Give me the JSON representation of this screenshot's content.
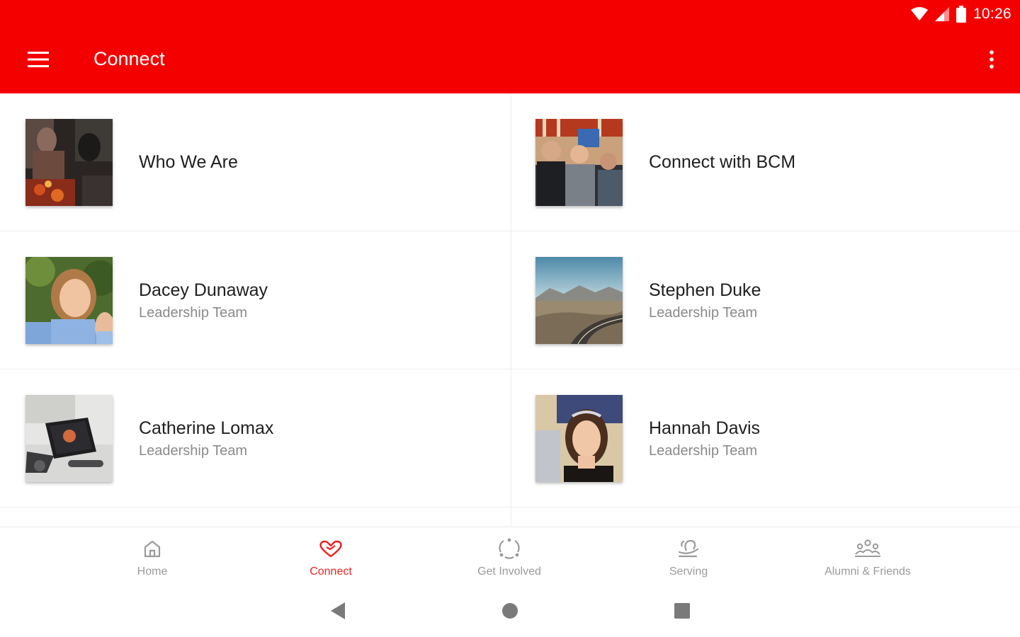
{
  "status_bar": {
    "time": "10:26",
    "icons": [
      "wifi-icon",
      "signal-icon",
      "battery-icon"
    ]
  },
  "app_bar": {
    "title": "Connect",
    "menu_icon": "hamburger-menu-icon",
    "overflow_icon": "more-vertical-icon",
    "background_color": "#f50000"
  },
  "cards": [
    {
      "title": "Who We Are",
      "subtitle": "",
      "image": "group-campfire-photo"
    },
    {
      "title": "Connect with BCM",
      "subtitle": "",
      "image": "students-cheering-photo"
    },
    {
      "title": "Dacey Dunaway",
      "subtitle": "Leadership Team",
      "image": "portrait-photo"
    },
    {
      "title": "Stephen Duke",
      "subtitle": "Leadership Team",
      "image": "desert-road-photo"
    },
    {
      "title": "Catherine Lomax",
      "subtitle": "Leadership Team",
      "image": "tablet-desk-photo"
    },
    {
      "title": "Hannah Davis",
      "subtitle": "Leadership Team",
      "image": "portrait-photo"
    }
  ],
  "bottom_nav": {
    "active_color": "#f02020",
    "items": [
      {
        "label": "Home",
        "icon": "home-icon",
        "active": false
      },
      {
        "label": "Connect",
        "icon": "connect-heart-icon",
        "active": true
      },
      {
        "label": "Get Involved",
        "icon": "get-involved-icon",
        "active": false
      },
      {
        "label": "Serving",
        "icon": "serving-icon",
        "active": false
      },
      {
        "label": "Alumni & Friends",
        "icon": "alumni-group-icon",
        "active": false
      }
    ]
  },
  "system_nav": {
    "icons": [
      "back-icon",
      "home-circle-icon",
      "recents-icon"
    ]
  }
}
